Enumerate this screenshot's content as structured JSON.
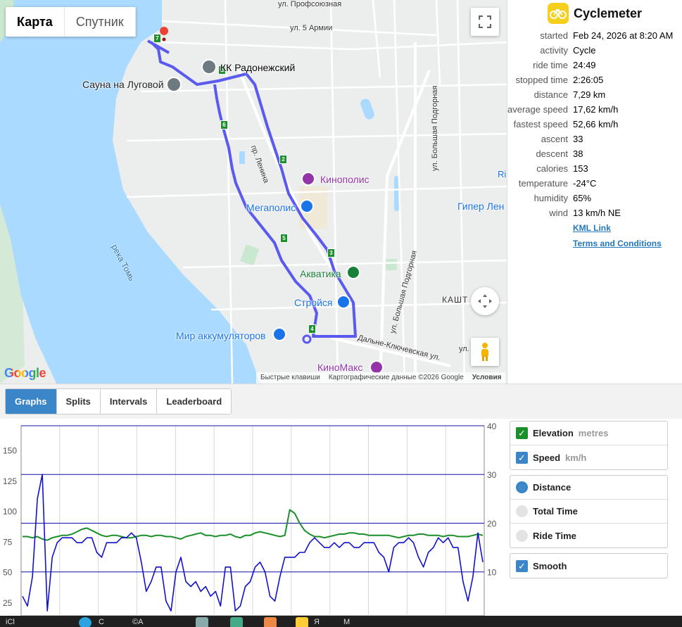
{
  "map": {
    "map_type_tabs": [
      "Карта",
      "Спутник"
    ],
    "active_map_type": "Карта",
    "pois": [
      {
        "label": "КК Радонежский",
        "color": "#222222"
      },
      {
        "label": "Сауна на Луговой",
        "color": "#222222"
      },
      {
        "label": "Кинополис",
        "color": "#9334a8"
      },
      {
        "label": "Мегаполис",
        "color": "#1a73e8"
      },
      {
        "label": "Гипер Лен",
        "color": "#1a73e8"
      },
      {
        "label": "Акватика",
        "color": "#188038"
      },
      {
        "label": "Стройся",
        "color": "#1a73e8"
      },
      {
        "label": "Мир аккумуляторов",
        "color": "#1a73e8"
      },
      {
        "label": "КиноМакс",
        "color": "#9334a8"
      },
      {
        "label": "КАШТ",
        "color": "#333333"
      },
      {
        "label": "Ri",
        "color": "#1a73e8"
      }
    ],
    "streets": [
      "ул. Профсоюзная",
      "ул. 5 Армии",
      "пр. Ленина",
      "ул. Большая Подгорная",
      "ул. Большая Подгорная",
      "Дальне-Ключевская ул.",
      "ул. Мі",
      "река Томь"
    ],
    "route_markers": [
      "1",
      "2",
      "3",
      "4",
      "5",
      "6",
      "7"
    ],
    "footer": {
      "shortcuts": "Быстрые клавиши",
      "data": "Картографические данные ©2026 Google",
      "terms": "Условия"
    },
    "google_logo": "Google"
  },
  "sidebar": {
    "app_title": "Cyclemeter",
    "stats": [
      {
        "key": "started",
        "value": "Feb 24, 2026 at 8:20 AM"
      },
      {
        "key": "activity",
        "value": "Cycle"
      },
      {
        "key": "ride time",
        "value": "24:49"
      },
      {
        "key": "stopped time",
        "value": "2:26:05"
      },
      {
        "key": "distance",
        "value": "7,29 km"
      },
      {
        "key": "average speed",
        "value": "17,62 km/h"
      },
      {
        "key": "fastest speed",
        "value": "52,66 km/h"
      },
      {
        "key": "ascent",
        "value": "33"
      },
      {
        "key": "descent",
        "value": "38"
      },
      {
        "key": "calories",
        "value": "153"
      },
      {
        "key": "temperature",
        "value": "-24°C"
      },
      {
        "key": "humidity",
        "value": "65%"
      },
      {
        "key": "wind",
        "value": "13 km/h NE"
      }
    ],
    "links": [
      "KML Link",
      "Terms and Conditions"
    ]
  },
  "tabs": [
    "Graphs",
    "Splits",
    "Intervals",
    "Leaderboard"
  ],
  "active_tab": "Graphs",
  "graph_options": {
    "series_toggles": [
      {
        "label": "Elevation",
        "unit": "metres",
        "checked": true,
        "color": "#1a8f2a"
      },
      {
        "label": "Speed",
        "unit": "km/h",
        "checked": true,
        "color": "#3a86c8"
      }
    ],
    "x_axis_modes": [
      {
        "label": "Distance",
        "selected": true
      },
      {
        "label": "Total Time",
        "selected": false
      },
      {
        "label": "Ride Time",
        "selected": false
      }
    ],
    "smooth": {
      "label": "Smooth",
      "checked": true
    }
  },
  "chart_data": {
    "type": "line",
    "title": "",
    "left_axis_ticks": [
      25,
      50,
      75,
      100,
      125,
      150
    ],
    "right_axis_ticks": [
      10,
      20,
      30,
      40
    ],
    "left_ylim": [
      14,
      170
    ],
    "right_ylim": [
      1,
      40
    ],
    "series": [
      {
        "name": "Elevation",
        "axis": "left",
        "color": "#1a8f2a",
        "values": [
          79,
          79,
          78,
          79,
          77,
          76,
          78,
          79,
          80,
          80,
          81,
          83,
          85,
          86,
          84,
          82,
          80,
          79,
          80,
          80,
          79,
          78,
          78,
          79,
          80,
          80,
          79,
          80,
          80,
          79,
          79,
          78,
          77,
          79,
          80,
          81,
          82,
          80,
          80,
          79,
          80,
          80,
          81,
          79,
          78,
          80,
          80,
          82,
          83,
          82,
          81,
          80,
          79,
          80,
          101,
          98,
          90,
          84,
          81,
          79,
          79,
          78,
          79,
          80,
          81,
          81,
          82,
          82,
          81,
          81,
          80,
          80,
          80,
          80,
          80,
          79,
          78,
          79,
          80,
          80,
          81,
          81,
          80,
          80,
          80,
          79,
          80,
          80,
          79,
          79,
          79,
          80,
          81,
          80
        ]
      },
      {
        "name": "Speed",
        "axis": "right",
        "color": "#1111cc",
        "values": [
          5,
          3,
          9,
          25,
          30,
          2,
          13,
          16,
          17,
          17,
          17,
          16,
          16,
          17,
          17,
          14,
          13,
          16,
          16,
          16,
          17,
          17,
          18,
          17,
          12,
          6,
          8,
          11,
          11,
          4,
          2,
          10,
          13,
          8,
          7,
          8,
          6,
          7,
          5,
          6,
          3,
          11,
          11,
          2,
          3,
          7,
          8,
          11,
          12,
          10,
          5,
          4,
          9,
          13,
          13,
          13,
          14,
          14,
          16,
          17,
          16,
          15,
          15,
          16,
          15,
          16,
          16,
          15,
          15,
          16,
          16,
          16,
          14,
          13,
          10,
          15,
          16,
          16,
          17,
          16,
          13,
          11,
          14,
          15,
          17,
          16,
          17,
          15,
          15,
          8,
          4,
          9,
          18,
          12
        ]
      }
    ]
  },
  "taskbar": {
    "items": [
      "iCl",
      "С",
      "©A",
      "Я",
      "M"
    ]
  }
}
